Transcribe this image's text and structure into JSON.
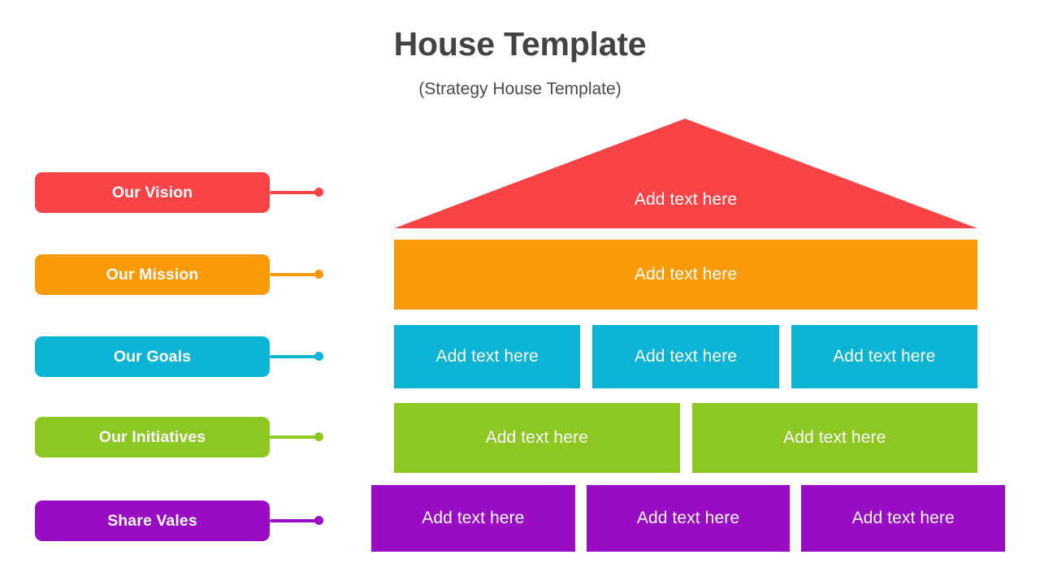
{
  "header": {
    "title": "House Template",
    "subtitle": "(Strategy House Template)"
  },
  "colors": {
    "red": "#f94347",
    "orange": "#f99a06",
    "cyan": "#0bb4d4",
    "green": "#8cc722",
    "purple": "#9a0bc4",
    "title_text": "#434343",
    "cell_text": "#ffffff",
    "background": "#ffffff"
  },
  "legend": {
    "items": [
      {
        "label": "Our Vision",
        "color": "#f94347"
      },
      {
        "label": "Our Mission",
        "color": "#f99a06"
      },
      {
        "label": "Our Goals",
        "color": "#0bb4d4"
      },
      {
        "label": "Our Initiatives",
        "color": "#8cc722"
      },
      {
        "label": "Share Vales",
        "color": "#9a0bc4"
      }
    ]
  },
  "house": {
    "roof": {
      "label": "Add text here",
      "color": "#f94347"
    },
    "rows": [
      {
        "name": "mission-row",
        "color": "#f99a06",
        "cells": [
          {
            "label": "Add text here"
          }
        ]
      },
      {
        "name": "goals-row",
        "color": "#0bb4d4",
        "cells": [
          {
            "label": "Add text here"
          },
          {
            "label": "Add text here"
          },
          {
            "label": "Add text here"
          }
        ]
      },
      {
        "name": "initiatives-row",
        "color": "#8cc722",
        "cells": [
          {
            "label": "Add text here"
          },
          {
            "label": "Add text here"
          }
        ]
      },
      {
        "name": "values-row",
        "color": "#9a0bc4",
        "cells": [
          {
            "label": "Add text here"
          },
          {
            "label": "Add text here"
          },
          {
            "label": "Add text here"
          }
        ]
      }
    ]
  }
}
